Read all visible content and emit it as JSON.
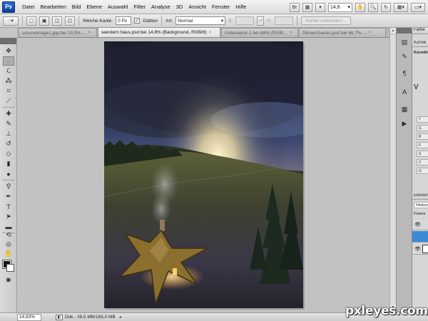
{
  "app": {
    "logo": "Ps"
  },
  "menu": {
    "items": [
      "Datei",
      "Bearbeiten",
      "Bild",
      "Ebene",
      "Auswahl",
      "Filter",
      "Analyse",
      "3D",
      "Ansicht",
      "Fenster",
      "Hilfe"
    ],
    "zoom": "14,8",
    "zoom_arrow": "▾"
  },
  "options": {
    "feather_label": "Weiche Kante:",
    "feather_value": "0 Px",
    "antialias_label": "Glätten",
    "antialias_checked": "✓",
    "style_label": "Art:",
    "style_value": "Normal",
    "width_label": "B:",
    "height_label": "H:",
    "refine_edge_label": "Kante verbessern..."
  },
  "tabs": [
    {
      "label": "sourceimage1.jpg bei 19,9% ...",
      "close": "×"
    },
    {
      "label": "seestern haus.psd bei 14,8% (Background, RGB/8)",
      "close": "×"
    },
    {
      "label": "Unbenannt-1 bei 68% (RGB/...",
      "close": "×"
    },
    {
      "label": "DinnerGuests.psd bei 66,7% ...",
      "close": "×"
    }
  ],
  "panels": {
    "color_tab": "Farbe",
    "adjust_tab": "Korrek",
    "adjust_title": "Korrekt",
    "adjust_items": [
      "T",
      "G",
      "B",
      "F",
      "S",
      "C",
      "G"
    ],
    "layers_tab": "Ebenen",
    "blend_mode": "Hindurc",
    "fill_label": "Fixiere"
  },
  "status": {
    "zoom": "14,83%",
    "doc_size": "Dok.: 39,5 MB/165,0 MB",
    "arrow": "▸"
  },
  "icons": {
    "tools": [
      "move-icon",
      "marquee-icon",
      "lasso-icon",
      "magic-wand-icon",
      "crop-icon",
      "eyedropper-icon",
      "healing-brush-icon",
      "brush-icon",
      "clone-stamp-icon",
      "history-brush-icon",
      "eraser-icon",
      "gradient-icon",
      "blur-icon",
      "dodge-icon",
      "pen-icon",
      "type-icon",
      "path-selection-icon",
      "rectangle-icon",
      "3d-rotate-icon",
      "3d-orbit-icon",
      "hand-icon",
      "zoom-icon",
      "quick-mask-icon"
    ],
    "dock": [
      "info-icon",
      "brushes-icon",
      "paragraph-icon",
      "character-icon",
      "history-icon",
      "actions-icon"
    ]
  },
  "watermark": "pxleyes.com"
}
